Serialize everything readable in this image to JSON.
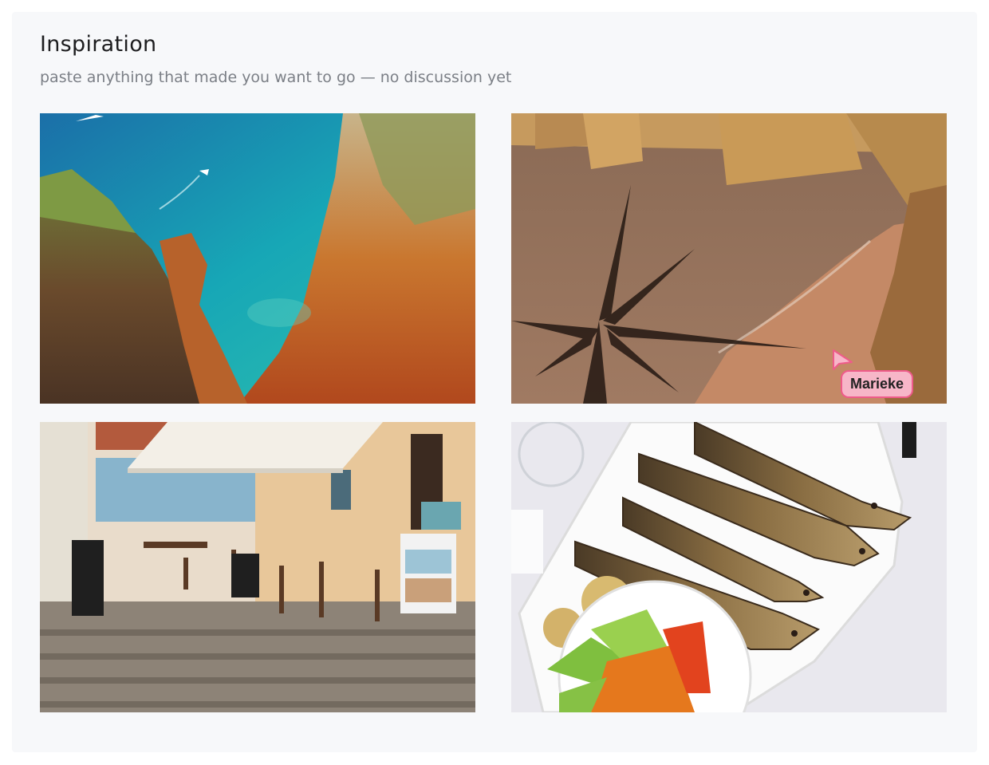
{
  "board": {
    "title": "Inspiration",
    "subtitle": "paste anything that made you want to go — no discussion yet"
  },
  "tiles": [
    {
      "subject": "turquoise sea cove between orange cliffs with boats"
    },
    {
      "subject": "sunset beach with rock formations and palm silhouette"
    },
    {
      "subject": "cobblestone street cafe with awning and sea view"
    },
    {
      "subject": "plate of grilled sardines with salad and potatoes"
    }
  ],
  "collaborator_cursor": {
    "name": "Marieke",
    "color": "#ef5b8a"
  }
}
